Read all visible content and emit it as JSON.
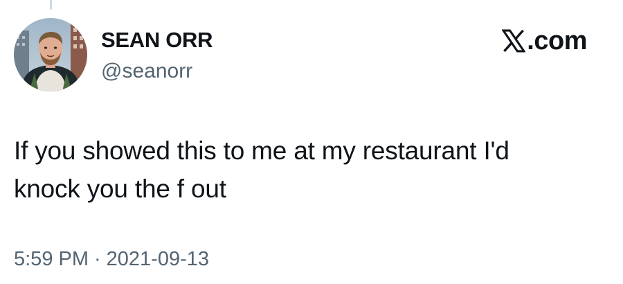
{
  "author": {
    "display_name": "SEAN ORR",
    "handle": "@seanorr",
    "avatar_icon": "profile-photo"
  },
  "brand": {
    "icon": "x-logo-icon",
    "text": ".com"
  },
  "tweet": {
    "lines": [
      "If you showed this to me at my restaurant I'd",
      "knock you the f out"
    ]
  },
  "meta": {
    "time": "5:59 PM",
    "separator": "·",
    "date": "2021-09-13"
  },
  "colors": {
    "text_primary": "#0f1419",
    "text_secondary": "#536471",
    "background": "#ffffff"
  }
}
